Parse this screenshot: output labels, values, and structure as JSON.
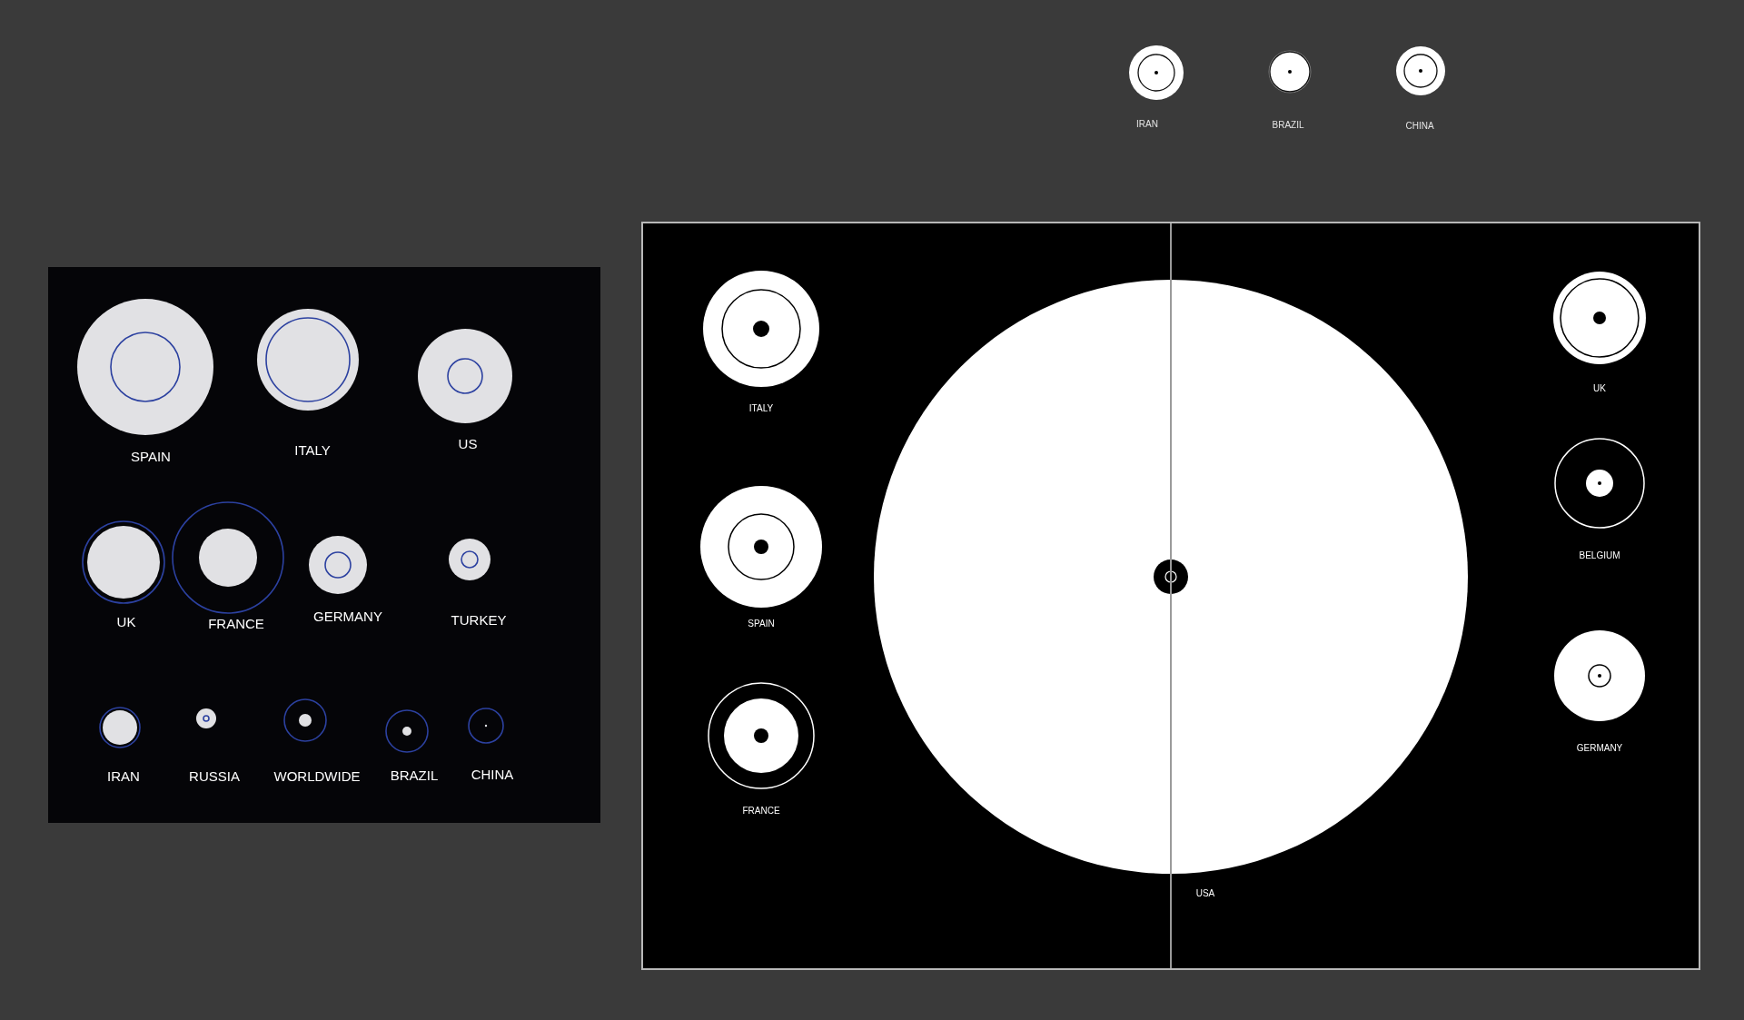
{
  "top_markers": [
    "IRAN",
    "BRAZIL",
    "CHINA"
  ],
  "legend_panel": {
    "labels": [
      "SPAIN",
      "ITALY",
      "US",
      "UK",
      "FRANCE",
      "GERMANY",
      "TURKEY",
      "IRAN",
      "RUSSIA",
      "WORLDWIDE",
      "BRAZIL",
      "CHINA"
    ]
  },
  "main_panel": {
    "labels": [
      "ITALY",
      "SPAIN",
      "FRANCE",
      "UK",
      "BELGIUM",
      "GERMANY",
      "USA"
    ]
  }
}
